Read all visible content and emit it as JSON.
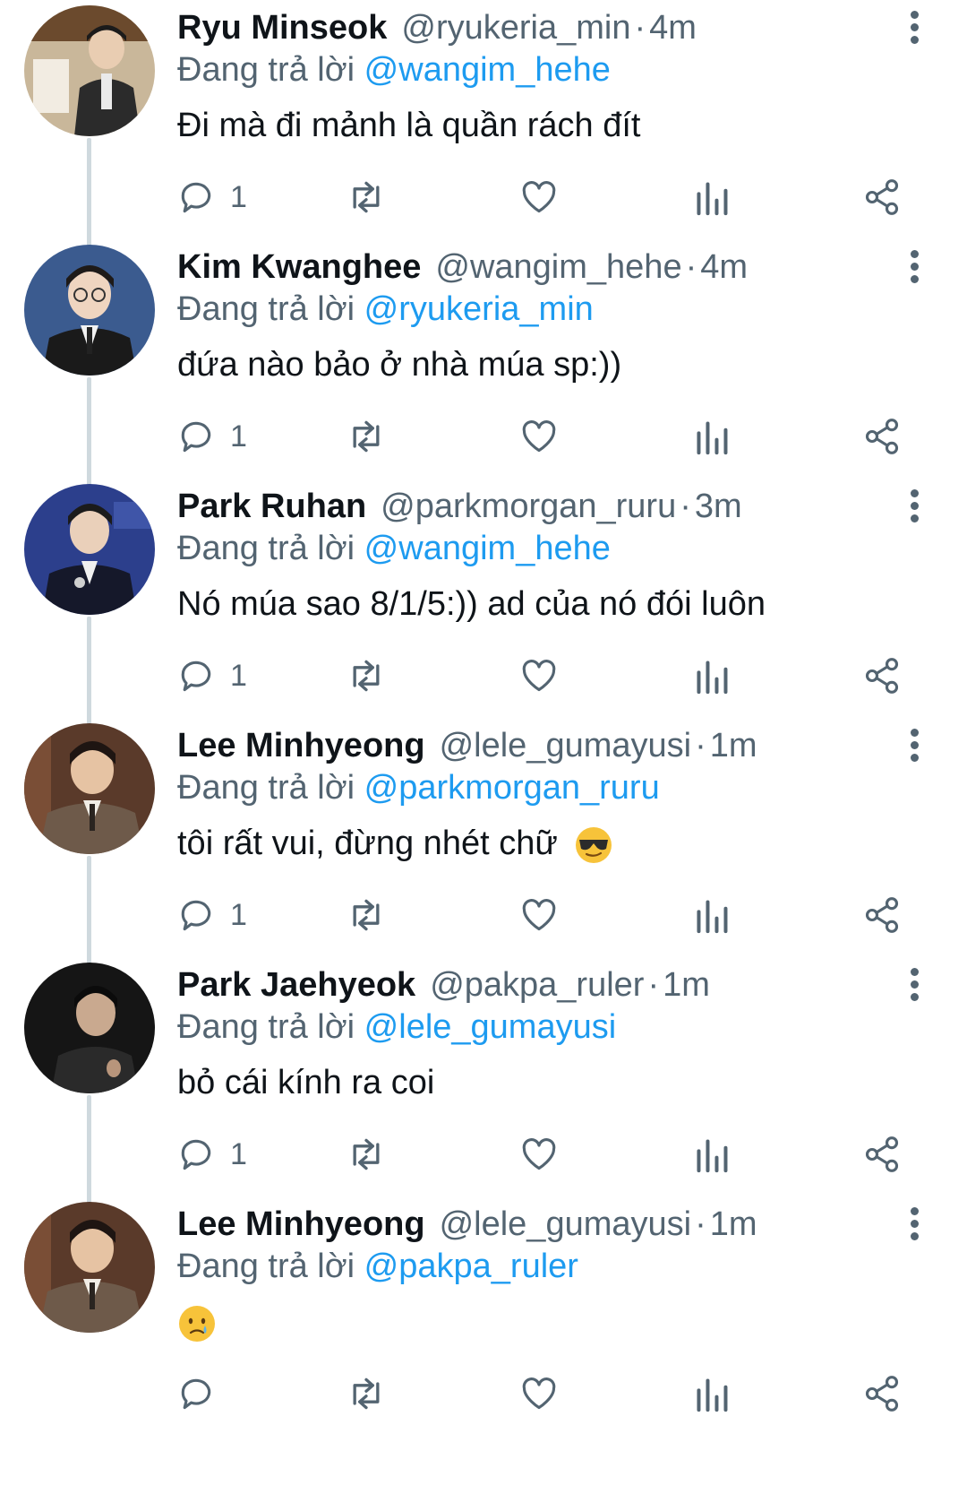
{
  "reply_prefix": "Đang trả lời",
  "separator": "·",
  "tweets": [
    {
      "name": "Ryu Minseok",
      "handle": "@ryukeria_min",
      "time": "4m",
      "reply_to": "@wangim_hehe",
      "text": "Đi mà đi mảnh là quần rách đít",
      "emoji": "",
      "reply_count": "1",
      "avatar_colors": {
        "bg": "#c9b79a",
        "shirt": "#2b2b2b",
        "face": "#e9cdb2"
      }
    },
    {
      "name": "Kim Kwanghee",
      "handle": "@wangim_hehe",
      "time": "4m",
      "reply_to": "@ryukeria_min",
      "text": "đứa nào bảo ở nhà múa sp:))",
      "emoji": "",
      "reply_count": "1",
      "avatar_colors": {
        "bg": "#3b5b8f",
        "shirt": "#1a1a1a",
        "face": "#efd5c0"
      }
    },
    {
      "name": "Park Ruhan",
      "handle": "@parkmorgan_ruru",
      "time": "3m",
      "reply_to": "@wangim_hehe",
      "text": "Nó múa sao 8/1/5:)) ad của nó đói luôn",
      "emoji": "",
      "reply_count": "1",
      "avatar_colors": {
        "bg": "#2c3f8c",
        "shirt": "#15182a",
        "face": "#ead0ba"
      }
    },
    {
      "name": "Lee Minhyeong",
      "handle": "@lele_gumayusi",
      "time": "1m",
      "reply_to": "@parkmorgan_ruru",
      "text": "tôi rất vui, đừng nhét chữ",
      "emoji": "sunglasses-emoji",
      "reply_count": "1",
      "avatar_colors": {
        "bg": "#5a3a2a",
        "shirt": "#6e5a4a",
        "face": "#e6c3a3"
      }
    },
    {
      "name": "Park Jaehyeok",
      "handle": "@pakpa_ruler",
      "time": "1m",
      "reply_to": "@lele_gumayusi",
      "text": "bỏ cái kính ra coi",
      "emoji": "",
      "reply_count": "1",
      "avatar_colors": {
        "bg": "#151515",
        "shirt": "#2a2a2a",
        "face": "#c9a98f"
      }
    },
    {
      "name": "Lee Minhyeong",
      "handle": "@lele_gumayusi",
      "time": "1m",
      "reply_to": "@pakpa_ruler",
      "text": "",
      "emoji": "crying-face-emoji",
      "reply_count": "",
      "avatar_colors": {
        "bg": "#5a3a2a",
        "shirt": "#6e5a4a",
        "face": "#e6c3a3"
      }
    }
  ],
  "icons": {
    "reply": "reply-icon",
    "retweet": "retweet-icon",
    "like": "heart-icon",
    "views": "views-icon",
    "share": "share-icon",
    "more": "more-vertical-icon"
  },
  "colors": {
    "name": "#0f1419",
    "secondary": "#536471",
    "mention": "#1d9bf0",
    "thread_line": "#cfd9de"
  }
}
